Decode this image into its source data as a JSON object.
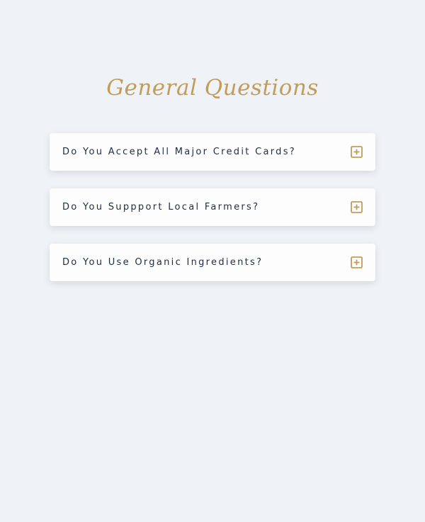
{
  "section": {
    "title": "General Questions"
  },
  "faq": {
    "items": [
      {
        "question": "Do You Accept All Major Credit Cards?",
        "icon": "plus-square-icon"
      },
      {
        "question": "Do You Suppport Local Farmers?",
        "icon": "plus-square-icon"
      },
      {
        "question": "Do You Use Organic Ingredients?",
        "icon": "plus-square-icon"
      }
    ]
  },
  "colors": {
    "background": "#eff3f7",
    "accent": "#c19d5c",
    "text": "#1e2d42",
    "card": "#fdfdfd"
  }
}
